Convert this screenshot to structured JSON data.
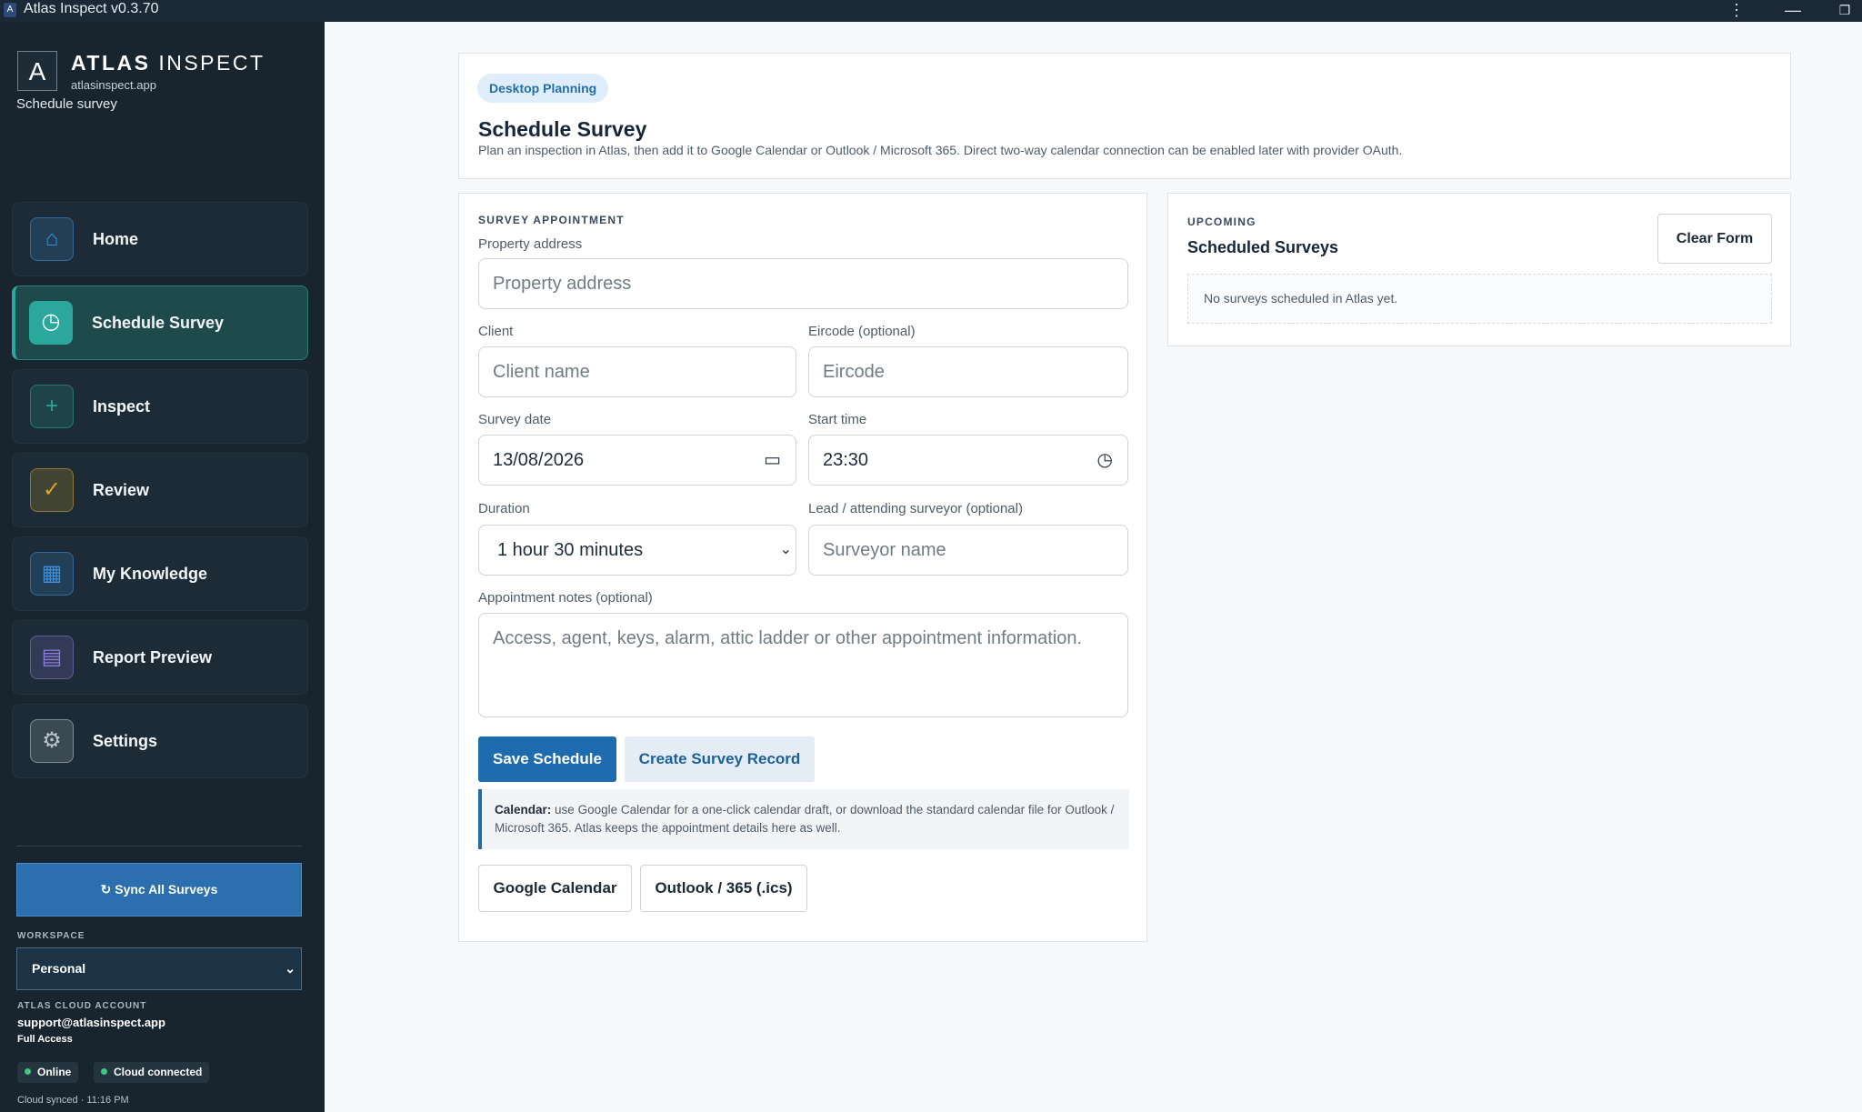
{
  "window": {
    "title": "Atlas Inspect v0.3.70",
    "app_icon": "A",
    "controls": [
      "⋮",
      "—",
      "❐"
    ]
  },
  "brand": {
    "logo": "A",
    "name_bold": "ATLAS",
    "name_light": "INSPECT",
    "domain": "atlasinspect.app",
    "subtitle": "Schedule survey"
  },
  "nav": {
    "items": [
      {
        "label": "Home",
        "icon": "home-icon",
        "glyph": "⌂",
        "color": "#3b8fd9",
        "active": false
      },
      {
        "label": "Schedule Survey",
        "icon": "clock-icon",
        "glyph": "◷",
        "color": "#2aa89c",
        "active": true
      },
      {
        "label": "Inspect",
        "icon": "plus-icon",
        "glyph": "+",
        "color": "#2aa89c",
        "active": false
      },
      {
        "label": "Review",
        "icon": "check-icon",
        "glyph": "✓",
        "color": "#d9a42e",
        "active": false
      },
      {
        "label": "My Knowledge",
        "icon": "grid-icon",
        "glyph": "▦",
        "color": "#3b8fd9",
        "active": false
      },
      {
        "label": "Report Preview",
        "icon": "document-icon",
        "glyph": "▤",
        "color": "#8a7ad9",
        "active": false
      },
      {
        "label": "Settings",
        "icon": "gear-icon",
        "glyph": "⚙",
        "color": "#b9c4ce",
        "active": false
      }
    ]
  },
  "sidebar_footer": {
    "sync_label": "↻ Sync All Surveys",
    "workspace_label": "WORKSPACE",
    "workspace_value": "Personal",
    "account_label": "ATLAS CLOUD ACCOUNT",
    "account_email": "support@atlasinspect.app",
    "access": "Full Access",
    "status_online": "Online",
    "status_cloud": "Cloud connected",
    "synced": "Cloud synced · 11:16 PM"
  },
  "header": {
    "badge": "Desktop Planning",
    "title": "Schedule Survey",
    "description": "Plan an inspection in Atlas, then add it to Google Calendar or Outlook / Microsoft 365. Direct two-way calendar connection can be enabled later with provider OAuth."
  },
  "form": {
    "section": "SURVEY APPOINTMENT",
    "address_label": "Property address",
    "address_placeholder": "Property address",
    "client_label": "Client",
    "client_placeholder": "Client name",
    "eircode_label": "Eircode (optional)",
    "eircode_placeholder": "Eircode",
    "date_label": "Survey date",
    "date_value": "13/08/2026",
    "time_label": "Start time",
    "time_value": "23:30",
    "duration_label": "Duration",
    "duration_value": "1 hour 30 minutes",
    "surveyor_label": "Lead / attending surveyor (optional)",
    "surveyor_placeholder": "Surveyor name",
    "notes_label": "Appointment notes (optional)",
    "notes_placeholder": "Access, agent, keys, alarm, attic ladder or other appointment information.",
    "save_label": "Save Schedule",
    "create_label": "Create Survey Record",
    "calendar_note_bold": "Calendar:",
    "calendar_note_text": "use Google Calendar for a one-click calendar draft, or download the standard calendar file for Outlook / Microsoft 365. Atlas keeps the appointment details here as well.",
    "google_label": "Google Calendar",
    "outlook_label": "Outlook / 365 (.ics)"
  },
  "upcoming": {
    "kicker": "UPCOMING",
    "title": "Scheduled Surveys",
    "clear_label": "Clear Form",
    "empty": "No surveys scheduled in Atlas yet."
  }
}
